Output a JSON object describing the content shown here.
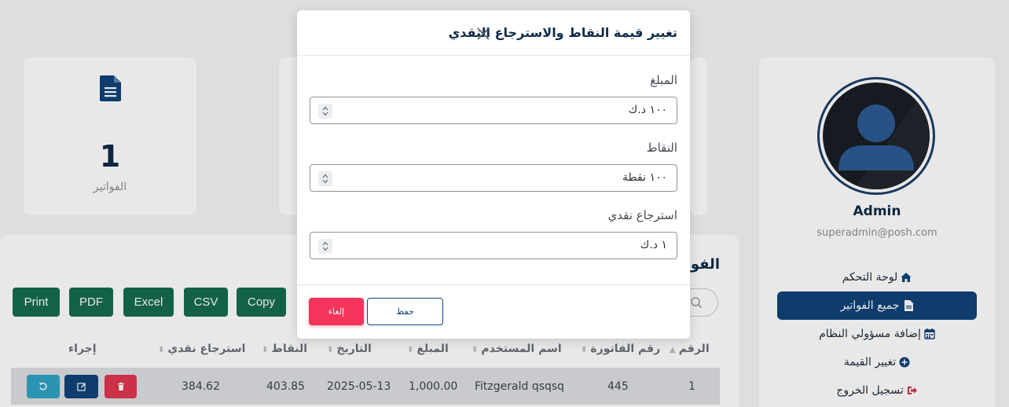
{
  "stats": {
    "invoices_count": "1",
    "invoices_label": "الفواتير"
  },
  "profile": {
    "name": "Admin",
    "email": "superadmin@posh.com"
  },
  "nav": {
    "items": [
      {
        "label": "لوحة التحكم",
        "icon": "home-icon"
      },
      {
        "label": "جميع الفواتير",
        "icon": "document-icon",
        "active": true
      },
      {
        "label": "إضافة مسؤولي النظام",
        "icon": "calendar-icon"
      },
      {
        "label": "تغيير القيمة",
        "icon": "plus-circle-icon"
      },
      {
        "label": "تسجيل الخروج",
        "icon": "logout-icon"
      }
    ]
  },
  "invoices": {
    "title": "الفواتير",
    "export_buttons": {
      "print": "Print",
      "pdf": "PDF",
      "excel": "Excel",
      "csv": "CSV",
      "copy": "Copy"
    },
    "columns": [
      "الرقم",
      "رقم الفاتورة",
      "اسم المستخدم",
      "المبلغ",
      "التاريخ",
      "النقاط",
      "استرجاع نقدي",
      "إجراء"
    ],
    "rows": [
      {
        "id": "1",
        "invoice_number": "445",
        "username": "Fitzgerald qsqsq",
        "amount": "1,000.00",
        "date": "2025-05-13",
        "points": "403.85",
        "cashback": "384.62"
      }
    ]
  },
  "modal": {
    "title": "تغيير قيمة النقاط والاسترجاع النقدي",
    "fields": [
      {
        "label": "المبلغ",
        "value": "١٠٠ د.ك"
      },
      {
        "label": "النقاط",
        "value": "١٠٠ نقطة"
      },
      {
        "label": "استرجاع نقدي",
        "value": "١ د.ك"
      }
    ],
    "save_label": "حفظ",
    "cancel_label": "إلغاء"
  },
  "colors": {
    "primary": "#104377",
    "export": "#156c4d",
    "danger": "#f4345a",
    "info": "#2fa3c4"
  }
}
